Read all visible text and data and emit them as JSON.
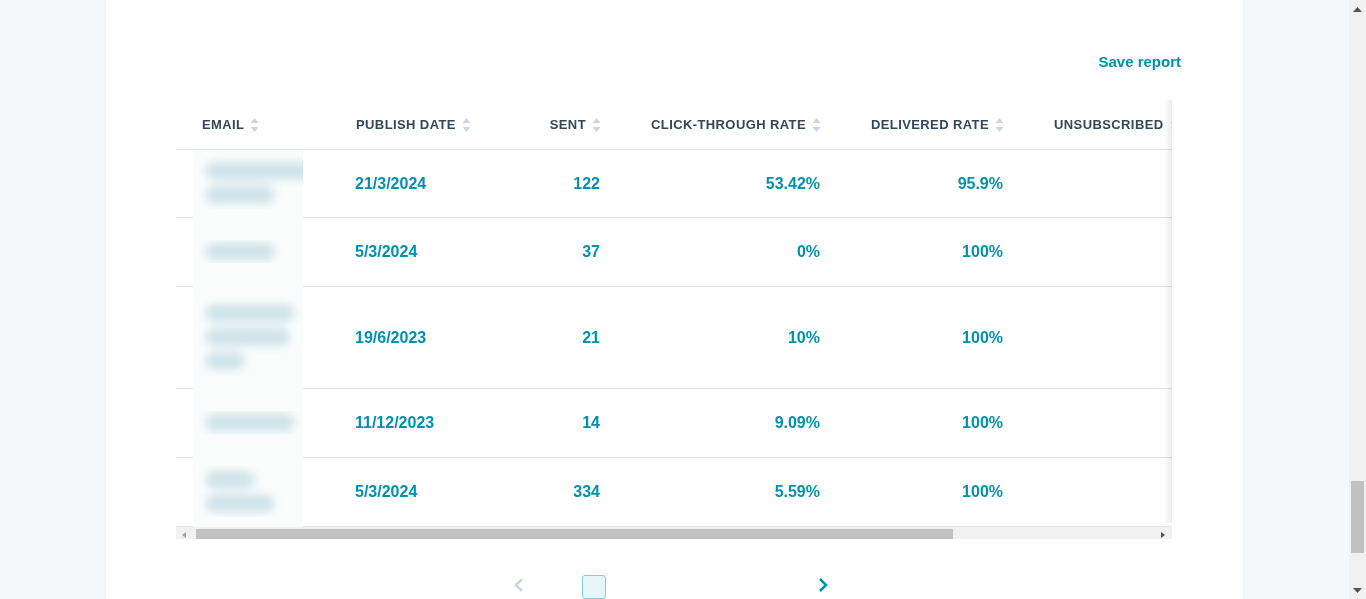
{
  "actions": {
    "save_report": "Save report"
  },
  "table": {
    "columns": [
      {
        "label": "EMAIL",
        "kind": "text"
      },
      {
        "label": "PUBLISH DATE",
        "kind": "text"
      },
      {
        "label": "SENT",
        "kind": "number"
      },
      {
        "label": "CLICK-THROUGH RATE",
        "kind": "number"
      },
      {
        "label": "DELIVERED RATE",
        "kind": "number"
      },
      {
        "label": "UNSUBSCRIBED",
        "kind": "text"
      }
    ],
    "rows": [
      {
        "publish_date": "21/3/2024",
        "sent": "122",
        "click_through_rate": "53.42%",
        "delivered_rate": "95.9%"
      },
      {
        "publish_date": "5/3/2024",
        "sent": "37",
        "click_through_rate": "0%",
        "delivered_rate": "100%"
      },
      {
        "publish_date": "19/6/2023",
        "sent": "21",
        "click_through_rate": "10%",
        "delivered_rate": "100%"
      },
      {
        "publish_date": "11/12/2023",
        "sent": "14",
        "click_through_rate": "9.09%",
        "delivered_rate": "100%"
      },
      {
        "publish_date": "5/3/2024",
        "sent": "334",
        "click_through_rate": "5.59%",
        "delivered_rate": "100%"
      }
    ]
  },
  "pagination": {
    "previous_disabled": true,
    "next_disabled": false
  }
}
